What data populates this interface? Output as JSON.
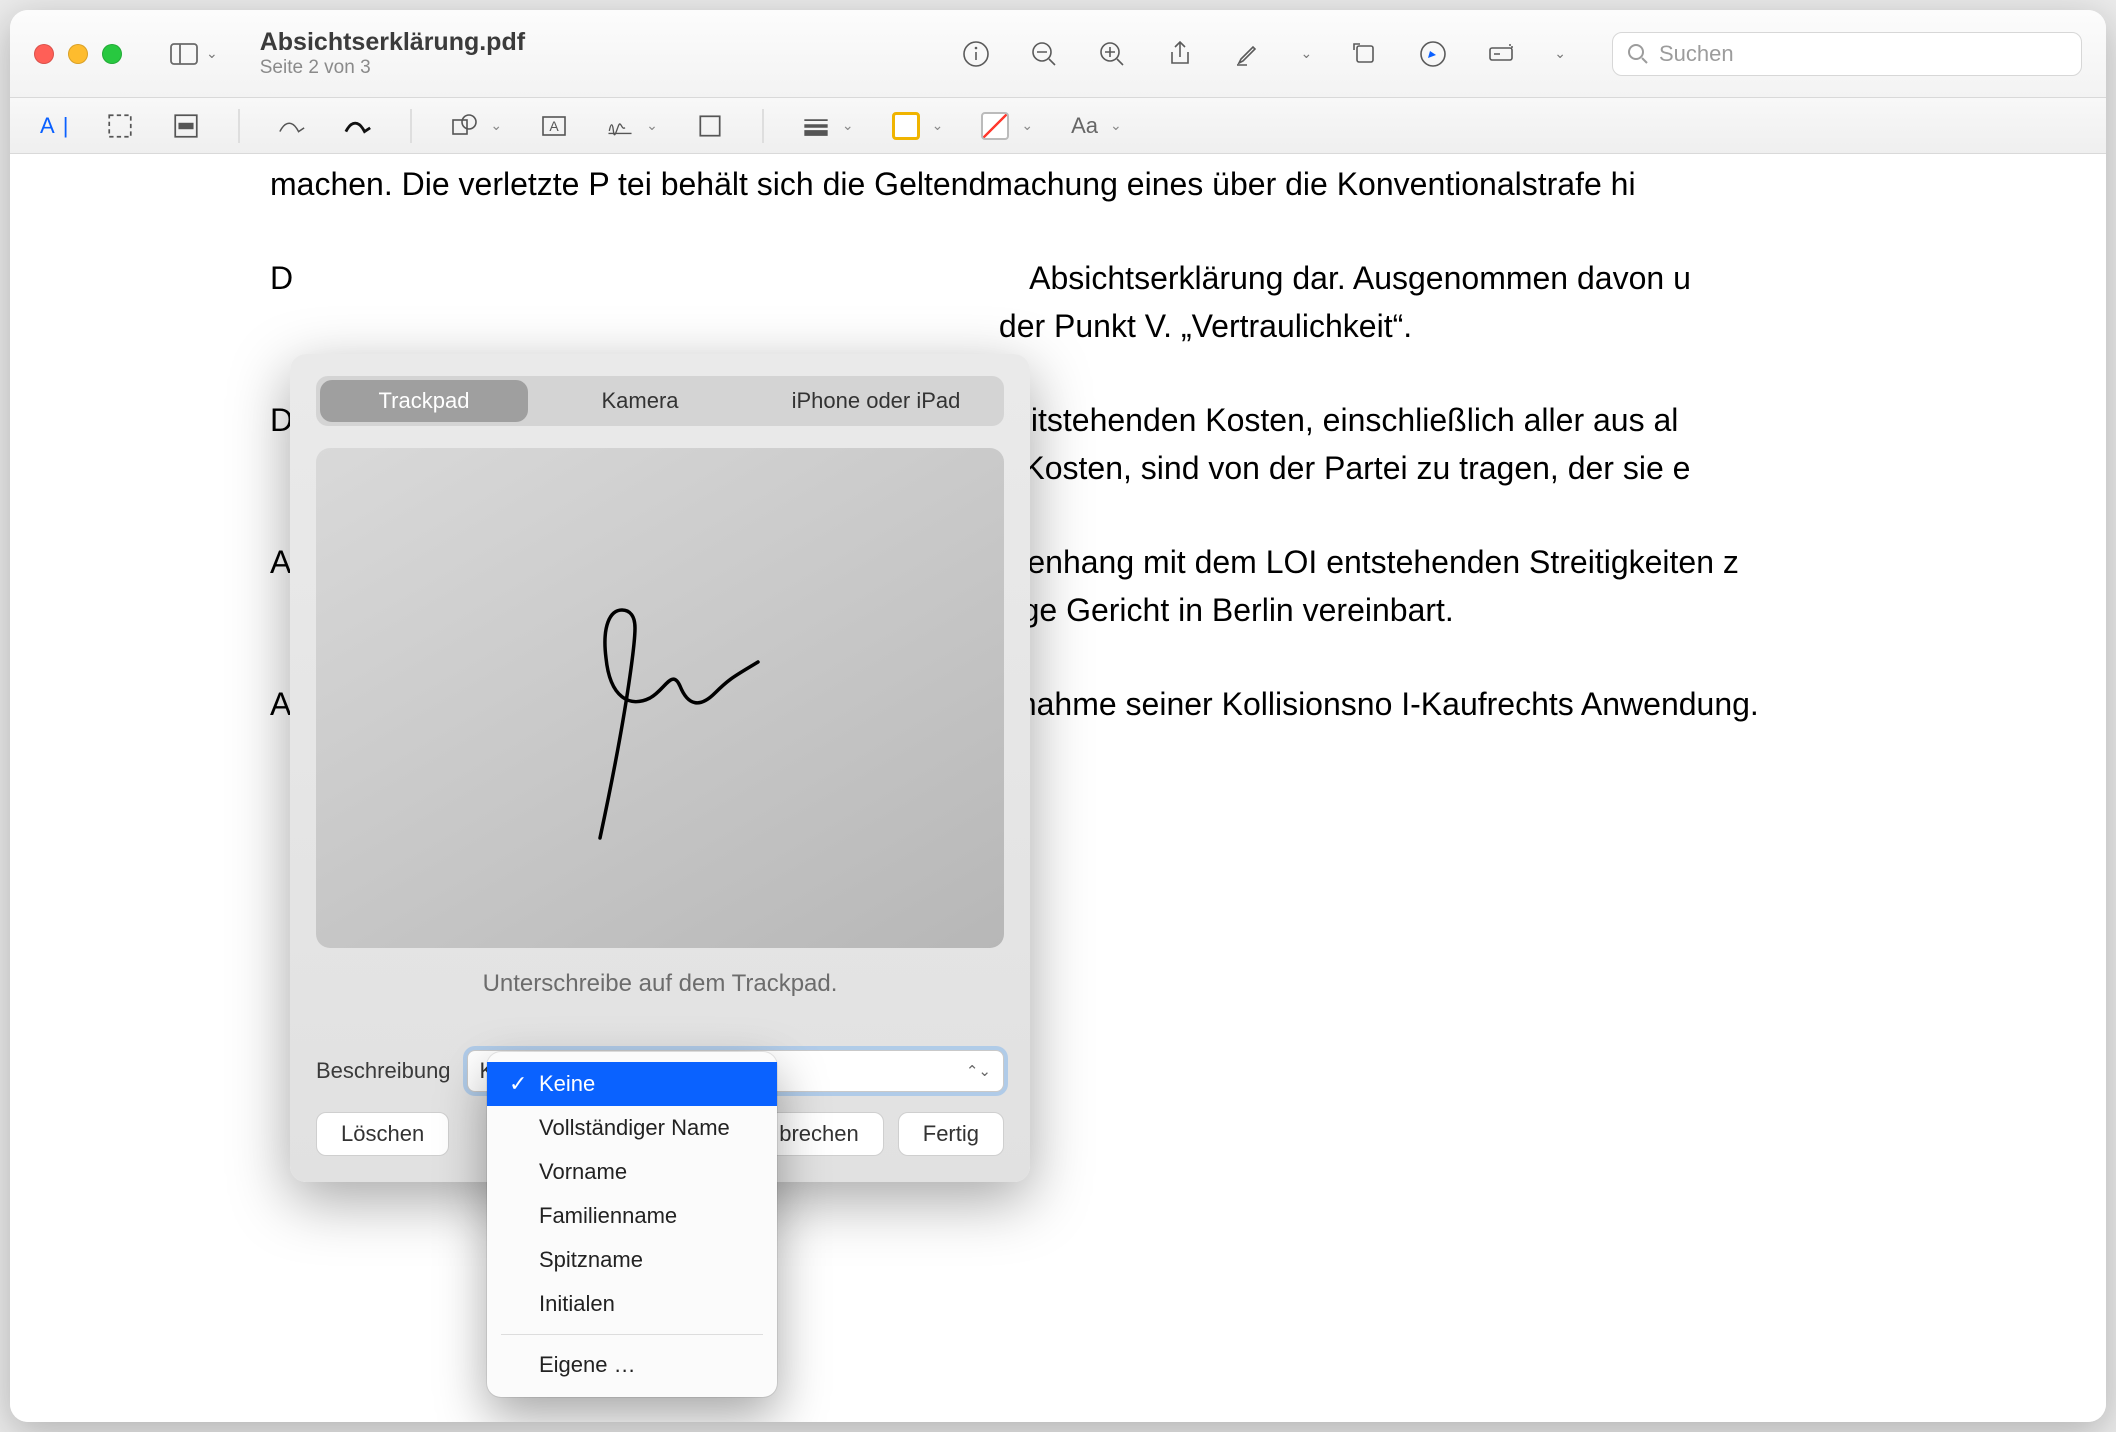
{
  "window": {
    "title": "Absichtserklärung.pdf",
    "subtitle": "Seite 2 von 3"
  },
  "search": {
    "placeholder": "Suchen"
  },
  "document": {
    "para1": "machen. Die verletzte P    tei behält sich die Geltendmachung eines über die Konventionalstrafe hi",
    "para2a": "D",
    "para2b": " Absichtserklärung dar. Ausgenommen davon u",
    "para2c": "der Punkt V. „Vertraulichkeit“.",
    "para3a": "D",
    "para3b": "itstehenden Kosten, einschließlich aller aus al",
    "para3c": "en Kosten, sind von der Partei zu tragen, der sie e",
    "para4a": "A",
    "para4b": "enhang mit dem LOI entstehenden Streitigkeiten z",
    "para4c": "ndige Gericht in Berlin vereinbart.",
    "para5": "Auf diese Ve                                ussschließlich deutsches Recht mit Ausnahme seiner Kollisionsno                               I-Kaufrechts Anwendung."
  },
  "signature": {
    "tabs": {
      "trackpad": "Trackpad",
      "camera": "Kamera",
      "iphone": "iPhone oder iPad"
    },
    "caption": "Unterschreibe auf dem Trackpad.",
    "desc_label": "Beschreibung",
    "desc_selected": "Keine",
    "buttons": {
      "clear": "Löschen",
      "cancel": "brechen",
      "done": "Fertig"
    }
  },
  "dropdown": {
    "items": {
      "none": "Keine",
      "fullname": "Vollständiger Name",
      "firstname": "Vorname",
      "lastname": "Familienname",
      "nickname": "Spitzname",
      "initials": "Initialen",
      "custom": "Eigene …"
    }
  }
}
